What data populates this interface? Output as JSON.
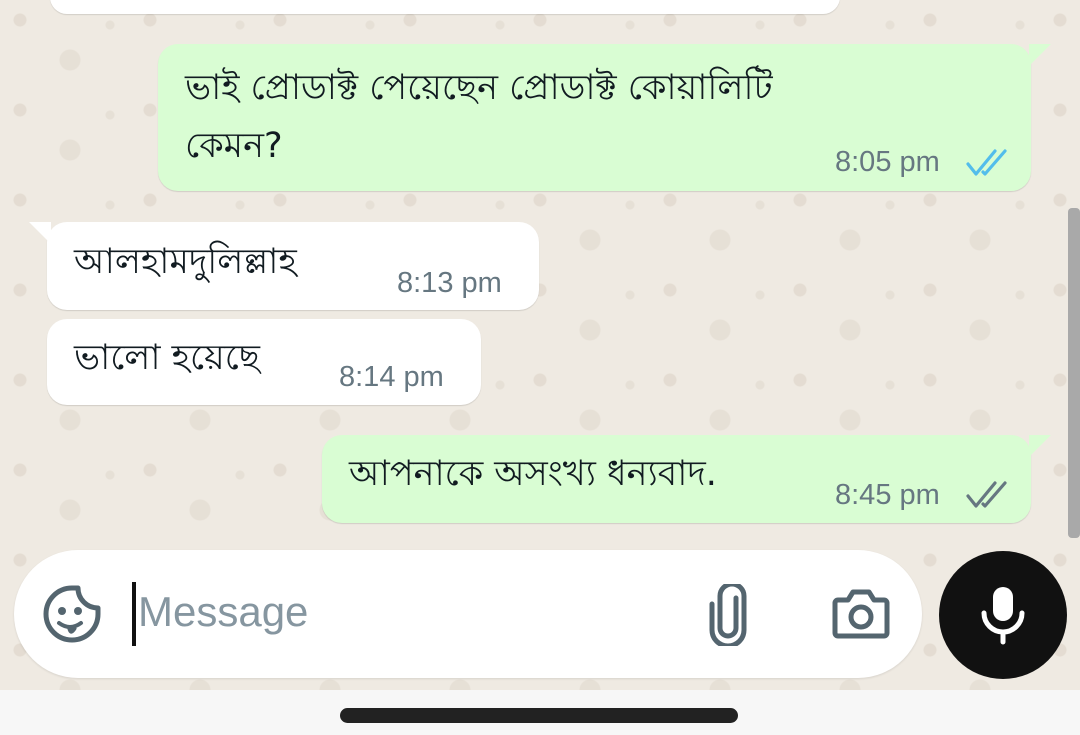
{
  "messages": [
    {
      "direction": "outgoing",
      "lines": [
        "ভাই প্রোডাক্ট পেয়েছেন প্রোডাক্ট কোয়ালিটি",
        "কেমন?"
      ],
      "time": "8:05 pm",
      "status": "read"
    },
    {
      "direction": "incoming",
      "text": "আলহামদুলিল্লাহ",
      "time": "8:13 pm"
    },
    {
      "direction": "incoming",
      "text": "ভালো হয়েছে",
      "time": "8:14 pm"
    },
    {
      "direction": "outgoing",
      "text": "আপনাকে অসংখ্য ধন্যবাদ.",
      "time": "8:45 pm",
      "status": "delivered"
    }
  ],
  "composer": {
    "placeholder": "Message",
    "icons": [
      "sticker-icon",
      "paperclip-icon",
      "camera-icon"
    ]
  },
  "mic_button": {
    "icon": "microphone-icon"
  },
  "colors": {
    "background": "#efeae2",
    "outgoing_bubble": "#d9fdd3",
    "incoming_bubble": "#ffffff",
    "read_tick": "#53bdeb",
    "delivered_tick": "#667781",
    "mic_button": "#111111"
  }
}
